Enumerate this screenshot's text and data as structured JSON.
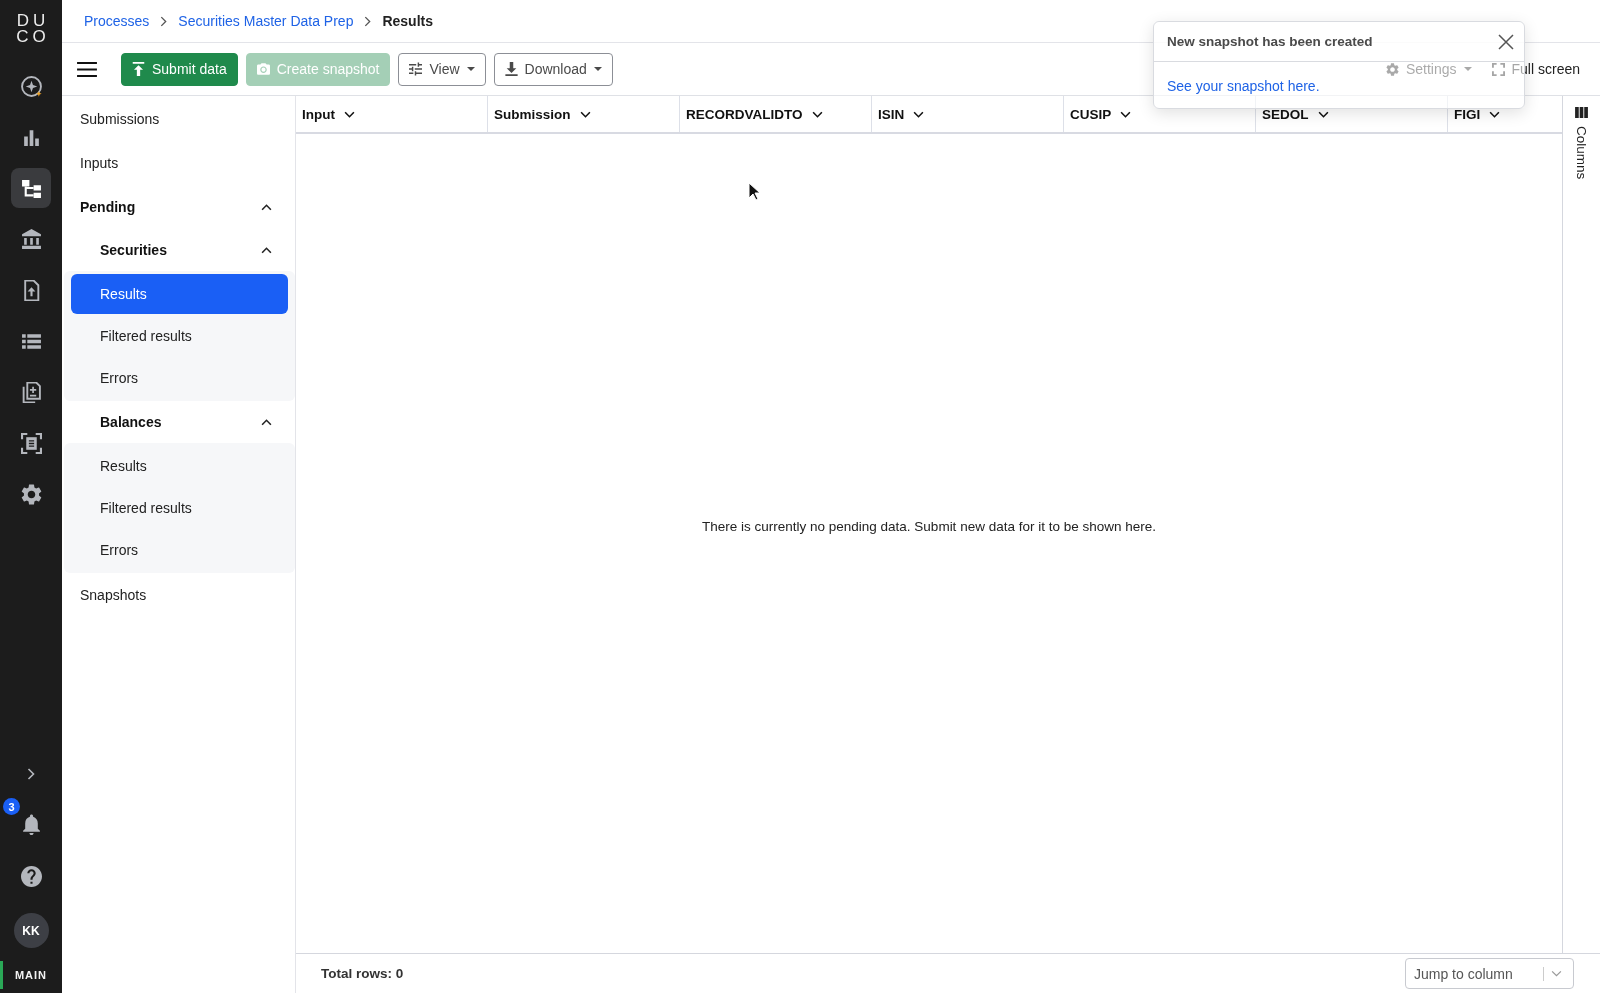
{
  "nav_rail": {
    "logo": [
      "DU",
      "CO"
    ],
    "items": [
      {
        "selected": false
      },
      {
        "selected": false
      },
      {
        "selected": true
      },
      {
        "selected": false
      },
      {
        "selected": false
      },
      {
        "selected": false
      },
      {
        "selected": false
      },
      {
        "selected": false
      },
      {
        "selected": false
      }
    ],
    "notifications": {
      "badge": "3"
    },
    "avatar": {
      "initials": "KK"
    },
    "workspace": {
      "label": "MAIN"
    }
  },
  "breadcrumbs": [
    {
      "label": "Processes",
      "kind": "link"
    },
    {
      "label": "Securities Master Data Prep",
      "kind": "link"
    },
    {
      "label": "Results",
      "kind": "current"
    }
  ],
  "toolbar": {
    "buttons": [
      {
        "label": "Submit data",
        "kind": "primary",
        "disabled": false
      },
      {
        "label": "Create snapshot",
        "kind": "primary",
        "disabled": true
      },
      {
        "label": "View",
        "kind": "menu",
        "disabled": false
      },
      {
        "label": "Download",
        "kind": "menu",
        "disabled": false
      }
    ],
    "right_buttons": [
      {
        "label": "Settings",
        "kind": "menu"
      },
      {
        "label": "Full screen",
        "kind": "plain"
      }
    ]
  },
  "sidebar": {
    "items": [
      {
        "label": "Submissions",
        "selected": false
      },
      {
        "label": "Inputs",
        "selected": false
      },
      {
        "label": "Pending",
        "selected": false,
        "expanded": true,
        "children": [
          {
            "label": "Securities",
            "selected": false,
            "expanded": true,
            "children": [
              {
                "label": "Results",
                "selected": true
              },
              {
                "label": "Filtered results",
                "selected": false
              },
              {
                "label": "Errors",
                "selected": false
              }
            ]
          },
          {
            "label": "Balances",
            "selected": false,
            "expanded": true,
            "children": [
              {
                "label": "Results",
                "selected": false
              },
              {
                "label": "Filtered results",
                "selected": false
              },
              {
                "label": "Errors",
                "selected": false
              }
            ]
          }
        ]
      },
      {
        "label": "Snapshots",
        "selected": false
      }
    ]
  },
  "grid": {
    "columns": [
      "Input",
      "Submission",
      "RECORDVALIDTO",
      "ISIN",
      "CUSIP",
      "SEDOL",
      "FIGI"
    ],
    "empty_message": "There is currently no pending data. Submit new data for it to be shown here.",
    "side_panel": {
      "label": "Columns"
    }
  },
  "footer": {
    "total_rows": "Total rows: 0",
    "jump_to_column": {
      "placeholder": "Jump to column"
    }
  },
  "toast": {
    "title": "New snapshot has been created",
    "link": "See your snapshot here."
  }
}
